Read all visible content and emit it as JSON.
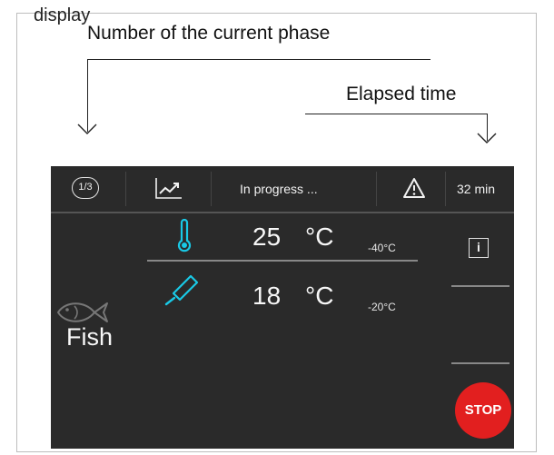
{
  "annotations": {
    "partial_top_text": "display",
    "current_phase_label": "Number of the current phase",
    "elapsed_time_label": "Elapsed time"
  },
  "device": {
    "topbar": {
      "phase_badge": "1/3",
      "chart_icon": "trend-chart-icon",
      "status": "In progress ...",
      "warning_icon": "warning-triangle-icon",
      "elapsed_time": "32 min"
    },
    "readings": [
      {
        "icon": "thermometer-icon",
        "value": "25",
        "unit": "°C",
        "target": "-40°C"
      },
      {
        "icon": "core-probe-icon",
        "value": "18",
        "unit": "°C",
        "target": "-20°C"
      }
    ],
    "product": {
      "icon": "fish-icon",
      "name": "Fish"
    },
    "info_label": "i",
    "stop_label": "STOP",
    "colors": {
      "accent": "#19c9e6",
      "stop": "#e21f1f",
      "background": "#2a2a2a"
    }
  }
}
